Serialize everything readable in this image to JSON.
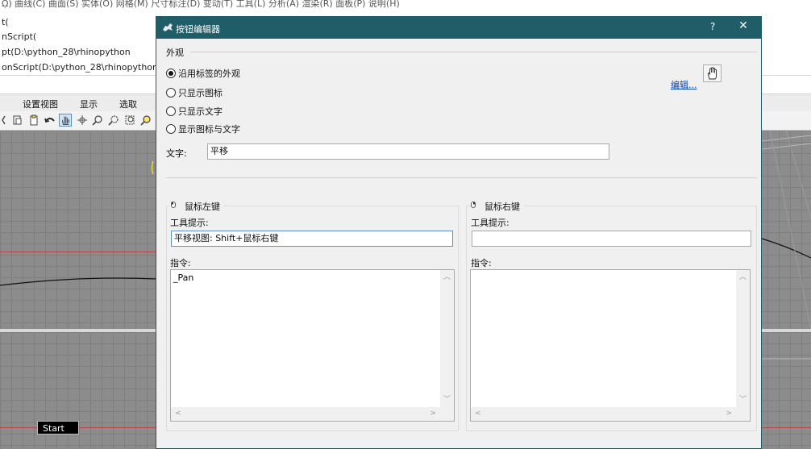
{
  "background": {
    "menubar_text": "ῼ)  曲线(C)  曲面(S)  实体(O)  网格(M)  尺寸标注(D)  变动(T)  工具(L)  分析(A)  渲染(R)  面板(P)  说明(H)",
    "command_history": [
      "t(",
      "nScript(",
      "pt(D:\\python_28\\rhinopython",
      "onScript(D:\\python_28\\rhinopython"
    ],
    "tabs": [
      "设置视图",
      "显示",
      "选取"
    ],
    "viewport_label": "Start"
  },
  "dialog": {
    "title": "按钮编辑器",
    "help_glyph": "?",
    "close_glyph": "✕",
    "appearance": {
      "section_label": "外观",
      "options": [
        {
          "label": "沿用标签的外观",
          "checked": true
        },
        {
          "label": "只显示图标",
          "checked": false
        },
        {
          "label": "只显示文字",
          "checked": false
        },
        {
          "label": "显示图标与文字",
          "checked": false
        }
      ],
      "edit_link": "编辑...",
      "icon_name": "pan-hand-icon"
    },
    "text_field": {
      "label": "文字:",
      "value": "平移"
    },
    "left_mouse": {
      "title": "鼠标左键",
      "tooltip_label": "工具提示:",
      "tooltip_value": "平移视图: Shift+鼠标右键",
      "command_label": "指令:",
      "command_value": "_Pan"
    },
    "right_mouse": {
      "title": "鼠标右键",
      "tooltip_label": "工具提示:",
      "tooltip_value": "",
      "command_label": "指令:",
      "command_value": ""
    }
  },
  "colors": {
    "titlebar": "#1f5d68",
    "dialog_bg": "#f0f0f0",
    "link": "#0645ad",
    "focus_border": "#5f8fd2"
  }
}
